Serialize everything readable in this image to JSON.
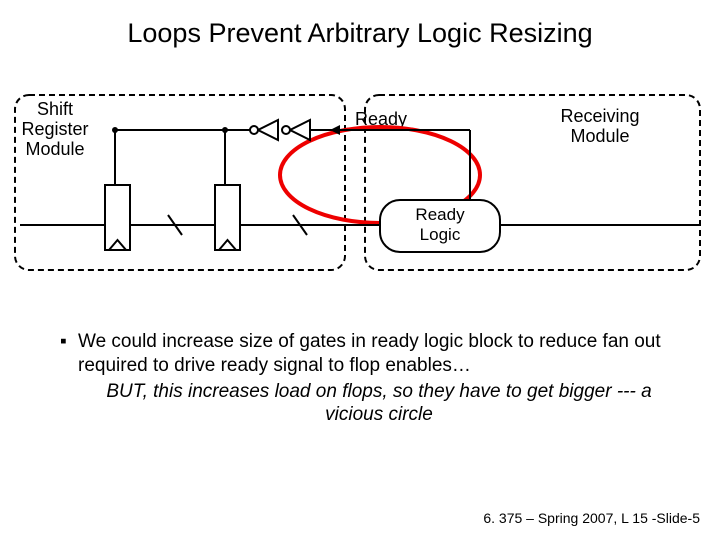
{
  "title": "Loops Prevent Arbitrary Logic Resizing",
  "diagram": {
    "shift_label_line1": "Shift",
    "shift_label_line2": "Register",
    "shift_label_line3": "Module",
    "ready_label": "Ready",
    "receiving_label_line1": "Receiving",
    "receiving_label_line2": "Module",
    "ready_logic_line1": "Ready",
    "ready_logic_line2": "Logic"
  },
  "bullet": {
    "mark": "▪",
    "text": "We could increase size of gates in ready logic block to reduce fan out required to drive ready signal to flop enables…",
    "italic": "BUT, this increases load on flops, so they have to get bigger --- a vicious circle"
  },
  "footer": "6. 375 – Spring 2007, L 15 -Slide-5"
}
